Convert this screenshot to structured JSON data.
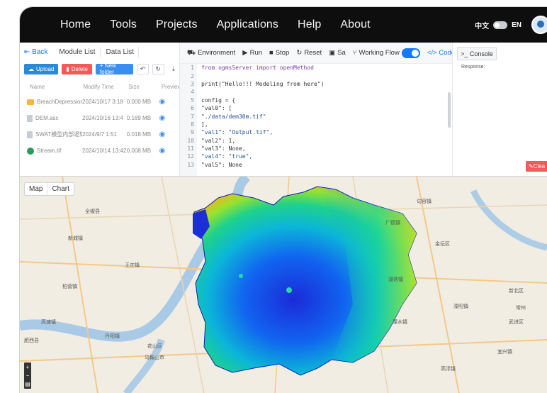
{
  "nav": {
    "links": [
      "Home",
      "Tools",
      "Projects",
      "Applications",
      "Help",
      "About"
    ],
    "lang_zh": "中文",
    "lang_en": "EN"
  },
  "left_panel": {
    "back": "Back",
    "tabs": [
      "Module List",
      "Data List"
    ],
    "upload": "Upload",
    "delete": "Delete",
    "new_folder": "+ New folder",
    "columns": [
      "Name",
      "Modify Time",
      "Size",
      "Preview"
    ],
    "files": [
      {
        "name": "BreachDepressionsLe...",
        "time": "2024/10/17 3:18",
        "size": "0.000 MB",
        "type": "folder"
      },
      {
        "name": "DEM.asc",
        "time": "2024/10/16 13:4",
        "size": "0.169 MB",
        "type": "file"
      },
      {
        "name": "SWAT模型内部逻辑组...",
        "time": "2024/9/7 1:51",
        "size": "0.018 MB",
        "type": "file"
      },
      {
        "name": "Stream.tif",
        "time": "2024/10/14 13:42",
        "size": "0.008 MB",
        "type": "tif"
      }
    ]
  },
  "editor": {
    "toolbar": {
      "environment": "Environment",
      "run": "Run",
      "stop": "Stop",
      "reset": "Reset",
      "save": "Sa",
      "working_flow": "Working Flow",
      "code": "</> Code"
    },
    "lines": [
      {
        "n": "1",
        "text": "from ogmsServer import openMethod",
        "cls": "kw"
      },
      {
        "n": "2",
        "text": "",
        "cls": ""
      },
      {
        "n": "3",
        "text": "print(\"Hello!!! Modeling from here\")",
        "cls": ""
      },
      {
        "n": "4",
        "text": "",
        "cls": ""
      },
      {
        "n": "5",
        "text": "config = {",
        "cls": ""
      },
      {
        "n": "6",
        "text": "\"val0\": [",
        "cls": ""
      },
      {
        "n": "7",
        "text": "\"./data/dem30m.tif\"",
        "cls": "str"
      },
      {
        "n": "8",
        "text": "],",
        "cls": ""
      },
      {
        "n": "9",
        "text": "\"val1\": \"Output.tif\",",
        "cls": "str"
      },
      {
        "n": "10",
        "text": "\"val2\": 1,",
        "cls": ""
      },
      {
        "n": "11",
        "text": "\"val3\": None,",
        "cls": ""
      },
      {
        "n": "12",
        "text": "\"val4\": \"true\",",
        "cls": "str"
      },
      {
        "n": "13",
        "text": "\"val5\": None",
        "cls": ""
      }
    ]
  },
  "console": {
    "tab": "Console",
    "response": "Response:",
    "clear": "Clea"
  },
  "map": {
    "tabs": [
      "Map",
      "Chart"
    ],
    "places": [
      "全椒县",
      "新城镇",
      "柏营镇",
      "高速镇",
      "肥西县",
      "王庄镇",
      "丹阳镇",
      "花山区",
      "马鞍山市",
      "广德镇",
      "金坛区",
      "溧水镇",
      "高淳镇",
      "溧阳镇",
      "宜兴镇",
      "句容镇",
      "湖熟镇",
      "新北区",
      "武进区",
      "常州"
    ]
  },
  "colors": {
    "nav_bg": "#0e0e0e",
    "accent": "#1677ff",
    "danger": "#f5585b"
  }
}
